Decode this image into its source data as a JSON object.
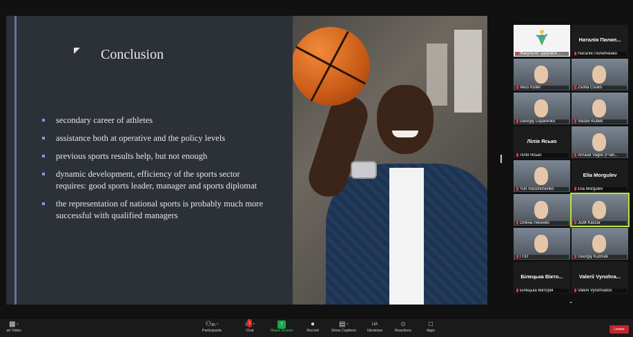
{
  "slide": {
    "title": "Conclusion",
    "bullets": [
      "secondary career of athletes",
      "assistance both at operative and the policy levels",
      "previous sports results help, but not enough",
      "dynamic development, efficiency of the sports sector requires: good sports leader, manager and sports diplomat",
      "the representation of national sports is probably much more successful with qualified managers"
    ]
  },
  "gallery": {
    "tiles": [
      {
        "name": "Факультет здоров'я ...",
        "type": "logo"
      },
      {
        "name": "Наталія Пилипченко",
        "type": "text",
        "big": "Наталія Пилип..."
      },
      {
        "name": "Akos Koller",
        "type": "video"
      },
      {
        "name": "Zsofia Csuko",
        "type": "video"
      },
      {
        "name": "Georgiy Loparenko",
        "type": "video"
      },
      {
        "name": "Vaclav Kubek",
        "type": "video"
      },
      {
        "name": "Лілія Ясько",
        "type": "text",
        "big": "Лілія Ясько"
      },
      {
        "name": "Arnaud Vaglio (Fran...",
        "type": "video"
      },
      {
        "name": "Yuri Voloshchenko",
        "type": "video"
      },
      {
        "name": "Elia Morgulev",
        "type": "text",
        "big": "Elia Morgulev"
      },
      {
        "name": "Олена Лисенко",
        "type": "video"
      },
      {
        "name": "Judit Kaszar",
        "type": "video",
        "active": true
      },
      {
        "name": "ГПО",
        "type": "video"
      },
      {
        "name": "Georgiy Kuzniuk",
        "type": "video"
      },
      {
        "name": "Білецька Вікторія",
        "type": "text",
        "big": "Білецька Вікто..."
      },
      {
        "name": "Valerii Vynohradov",
        "type": "text",
        "big": "Valerii Vynohra..."
      }
    ]
  },
  "toolbar": {
    "video_label": "art Video",
    "participants_label": "Participants",
    "participants_count": "85",
    "chat_label": "Chat",
    "chat_badge": "1",
    "share_label": "Share Screen",
    "record_label": "Record",
    "captions_label": "Show Captions",
    "language_label": "Ukrainian",
    "language_code": "UA",
    "reactions_label": "Reactions",
    "apps_label": "Apps",
    "leave_label": "Leave"
  },
  "colors": {
    "slide_bg": "#2c3138",
    "bullet_color": "#8f96d9",
    "active_outline": "#b9e23a",
    "leave": "#c3262b",
    "share_green": "#19a64a"
  }
}
